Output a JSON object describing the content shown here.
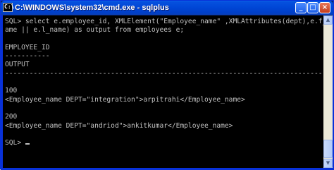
{
  "window": {
    "title": "C:\\WINDOWS\\system32\\cmd.exe - sqlplus",
    "icon": "cmd-icon",
    "icon_text": "C:\\",
    "buttons": {
      "minimize": "_",
      "maximize": "□",
      "close": "×"
    }
  },
  "console": {
    "lines": [
      "SQL> select e.employee_id, XMLElement(\"Employee_name\" ,XMLAttributes(dept),e.f_n",
      "ame || e.l_name) as output from employees e;",
      "",
      "EMPLOYEE_ID",
      "-----------",
      "OUTPUT",
      "--------------------------------------------------------------------------------",
      "",
      "100",
      "<Employee_name DEPT=\"integration\">arpitrahi</Employee_name>",
      "",
      "200",
      "<Employee_name DEPT=\"andriod\">ankitkumar</Employee_name>",
      ""
    ],
    "prompt": "SQL> "
  },
  "scrollbar": {
    "up": "▲",
    "down": "▼"
  }
}
